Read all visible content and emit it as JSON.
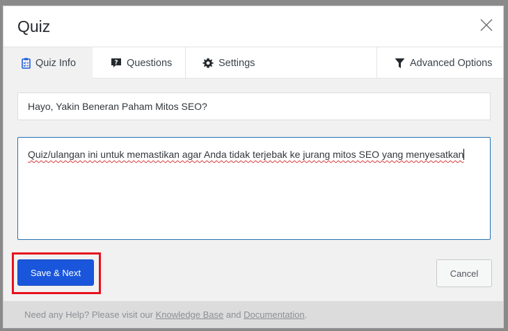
{
  "modal": {
    "title": "Quiz"
  },
  "tabs": [
    {
      "label": "Quiz Info",
      "icon": "clipboard-check-icon",
      "active": true
    },
    {
      "label": "Questions",
      "icon": "question-box-icon"
    },
    {
      "label": "Settings",
      "icon": "gear-icon"
    },
    {
      "label": "Advanced Options",
      "icon": "filter-icon"
    }
  ],
  "form": {
    "title_value": "Hayo, Yakin Beneran Paham Mitos SEO?",
    "description_value": "Quiz/ulangan ini untuk memastikan agar Anda tidak terjebak ke jurang mitos SEO yang menyesatkan"
  },
  "actions": {
    "save_label": "Save & Next",
    "cancel_label": "Cancel"
  },
  "footer": {
    "prefix": "Need any Help? Please visit our",
    "link1": "Knowledge Base",
    "conj": "and",
    "link2": "Documentation",
    "suffix": "."
  },
  "colors": {
    "primary": "#1a56db",
    "highlight": "#e8101d",
    "focus_border": "#2271b1"
  }
}
